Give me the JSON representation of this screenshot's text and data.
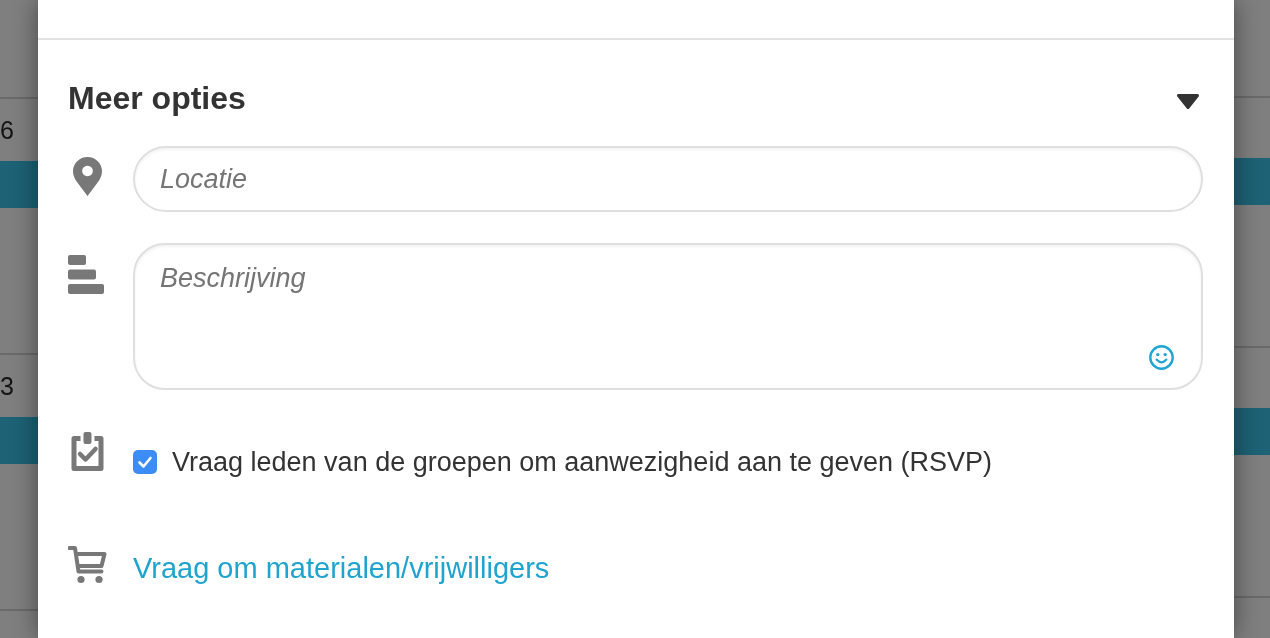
{
  "backdrop": {
    "rows": [
      {
        "number": "6"
      },
      {
        "number": "3"
      }
    ]
  },
  "dialog": {
    "more_options": {
      "title": "Meer opties",
      "expanded": true
    },
    "location": {
      "placeholder": "Locatie"
    },
    "description": {
      "placeholder": "Beschrijving"
    },
    "rsvp": {
      "label": "Vraag leden van de groepen om aanwezigheid aan te geven (RSVP)",
      "checked": true
    },
    "materials_link": {
      "label": "Vraag om materialen/vrijwilligers"
    }
  }
}
